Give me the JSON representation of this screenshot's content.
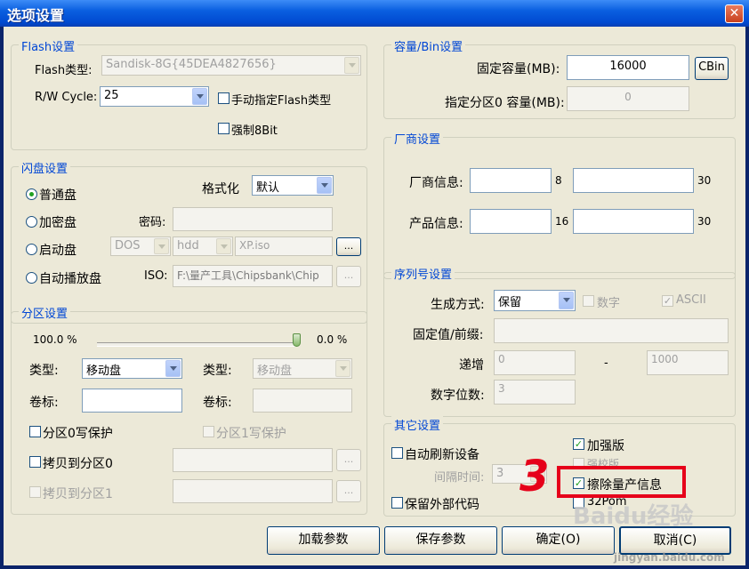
{
  "window": {
    "title": "选项设置",
    "close": "✕"
  },
  "flash": {
    "legend": "Flash设置",
    "type_label": "Flash类型:",
    "type_value": "Sandisk-8G{45DEA4827656}",
    "rw_label": "R/W Cycle:",
    "rw_value": "25",
    "manual_label": "手动指定Flash类型",
    "force8_label": "强制8Bit"
  },
  "disk": {
    "legend": "闪盘设置",
    "normal": "普通盘",
    "encrypt": "加密盘",
    "boot": "启动盘",
    "autoplay": "自动播放盘",
    "format_label": "格式化",
    "format_value": "默认",
    "password_label": "密码:",
    "dos": "DOS",
    "hdd": "hdd",
    "xp": "XP.iso",
    "iso_label": "ISO:",
    "iso_value": "F:\\量产工具\\Chipsbank\\Chip",
    "browse": "..."
  },
  "partition": {
    "legend": "分区设置",
    "pct_left": "100.0 %",
    "pct_right": "0.0 %",
    "type_label": "类型:",
    "type_value": "移动盘",
    "type2_label": "类型:",
    "type2_value": "移动盘",
    "vol_label": "卷标:",
    "vol2_label": "卷标:",
    "p0_wp": "分区0写保护",
    "p1_wp": "分区1写保护",
    "copy0": "拷贝到分区0",
    "copy1": "拷贝到分区1",
    "browse": "..."
  },
  "capacity": {
    "legend": "容量/Bin设置",
    "fixed_label": "固定容量(MB):",
    "fixed_value": "16000",
    "cbin": "CBin",
    "part0_label": "指定分区0 容量(MB):",
    "part0_value": "0"
  },
  "vendor": {
    "legend": "厂商设置",
    "vendor_label": "厂商信息:",
    "vendor_len": "8",
    "vendor_len2": "30",
    "product_label": "产品信息:",
    "product_len": "16",
    "product_len2": "30"
  },
  "serial": {
    "legend": "序列号设置",
    "gen_label": "生成方式:",
    "gen_value": "保留",
    "digit_label": "数字",
    "ascii_label": "ASCII",
    "prefix_label": "固定值/前缀:",
    "inc_label": "递增",
    "inc_from": "0",
    "dash": "-",
    "inc_to": "1000",
    "digits_label": "数字位数:",
    "digits_value": "3"
  },
  "other": {
    "legend": "其它设置",
    "auto_refresh": "自动刷新设备",
    "interval_label": "间隔时间:",
    "interval_value": "3",
    "keep_code": "保留外部代码",
    "enhanced": "加强版",
    "strong_check": "强校版",
    "erase_info": "擦除量产信息",
    "pom": "32Pom"
  },
  "buttons": {
    "load": "加载参数",
    "save": "保存参数",
    "ok": "确定(O)",
    "cancel": "取消(C)"
  },
  "annotation": {
    "number": "3"
  },
  "watermark": {
    "brand": "Baidu经验",
    "url": "jingyan.baidu.com"
  },
  "colors": {
    "title_bar": "#0a5fe0",
    "legend": "#0046d5",
    "face": "#ece9d8",
    "highlight": "#e6001a"
  }
}
